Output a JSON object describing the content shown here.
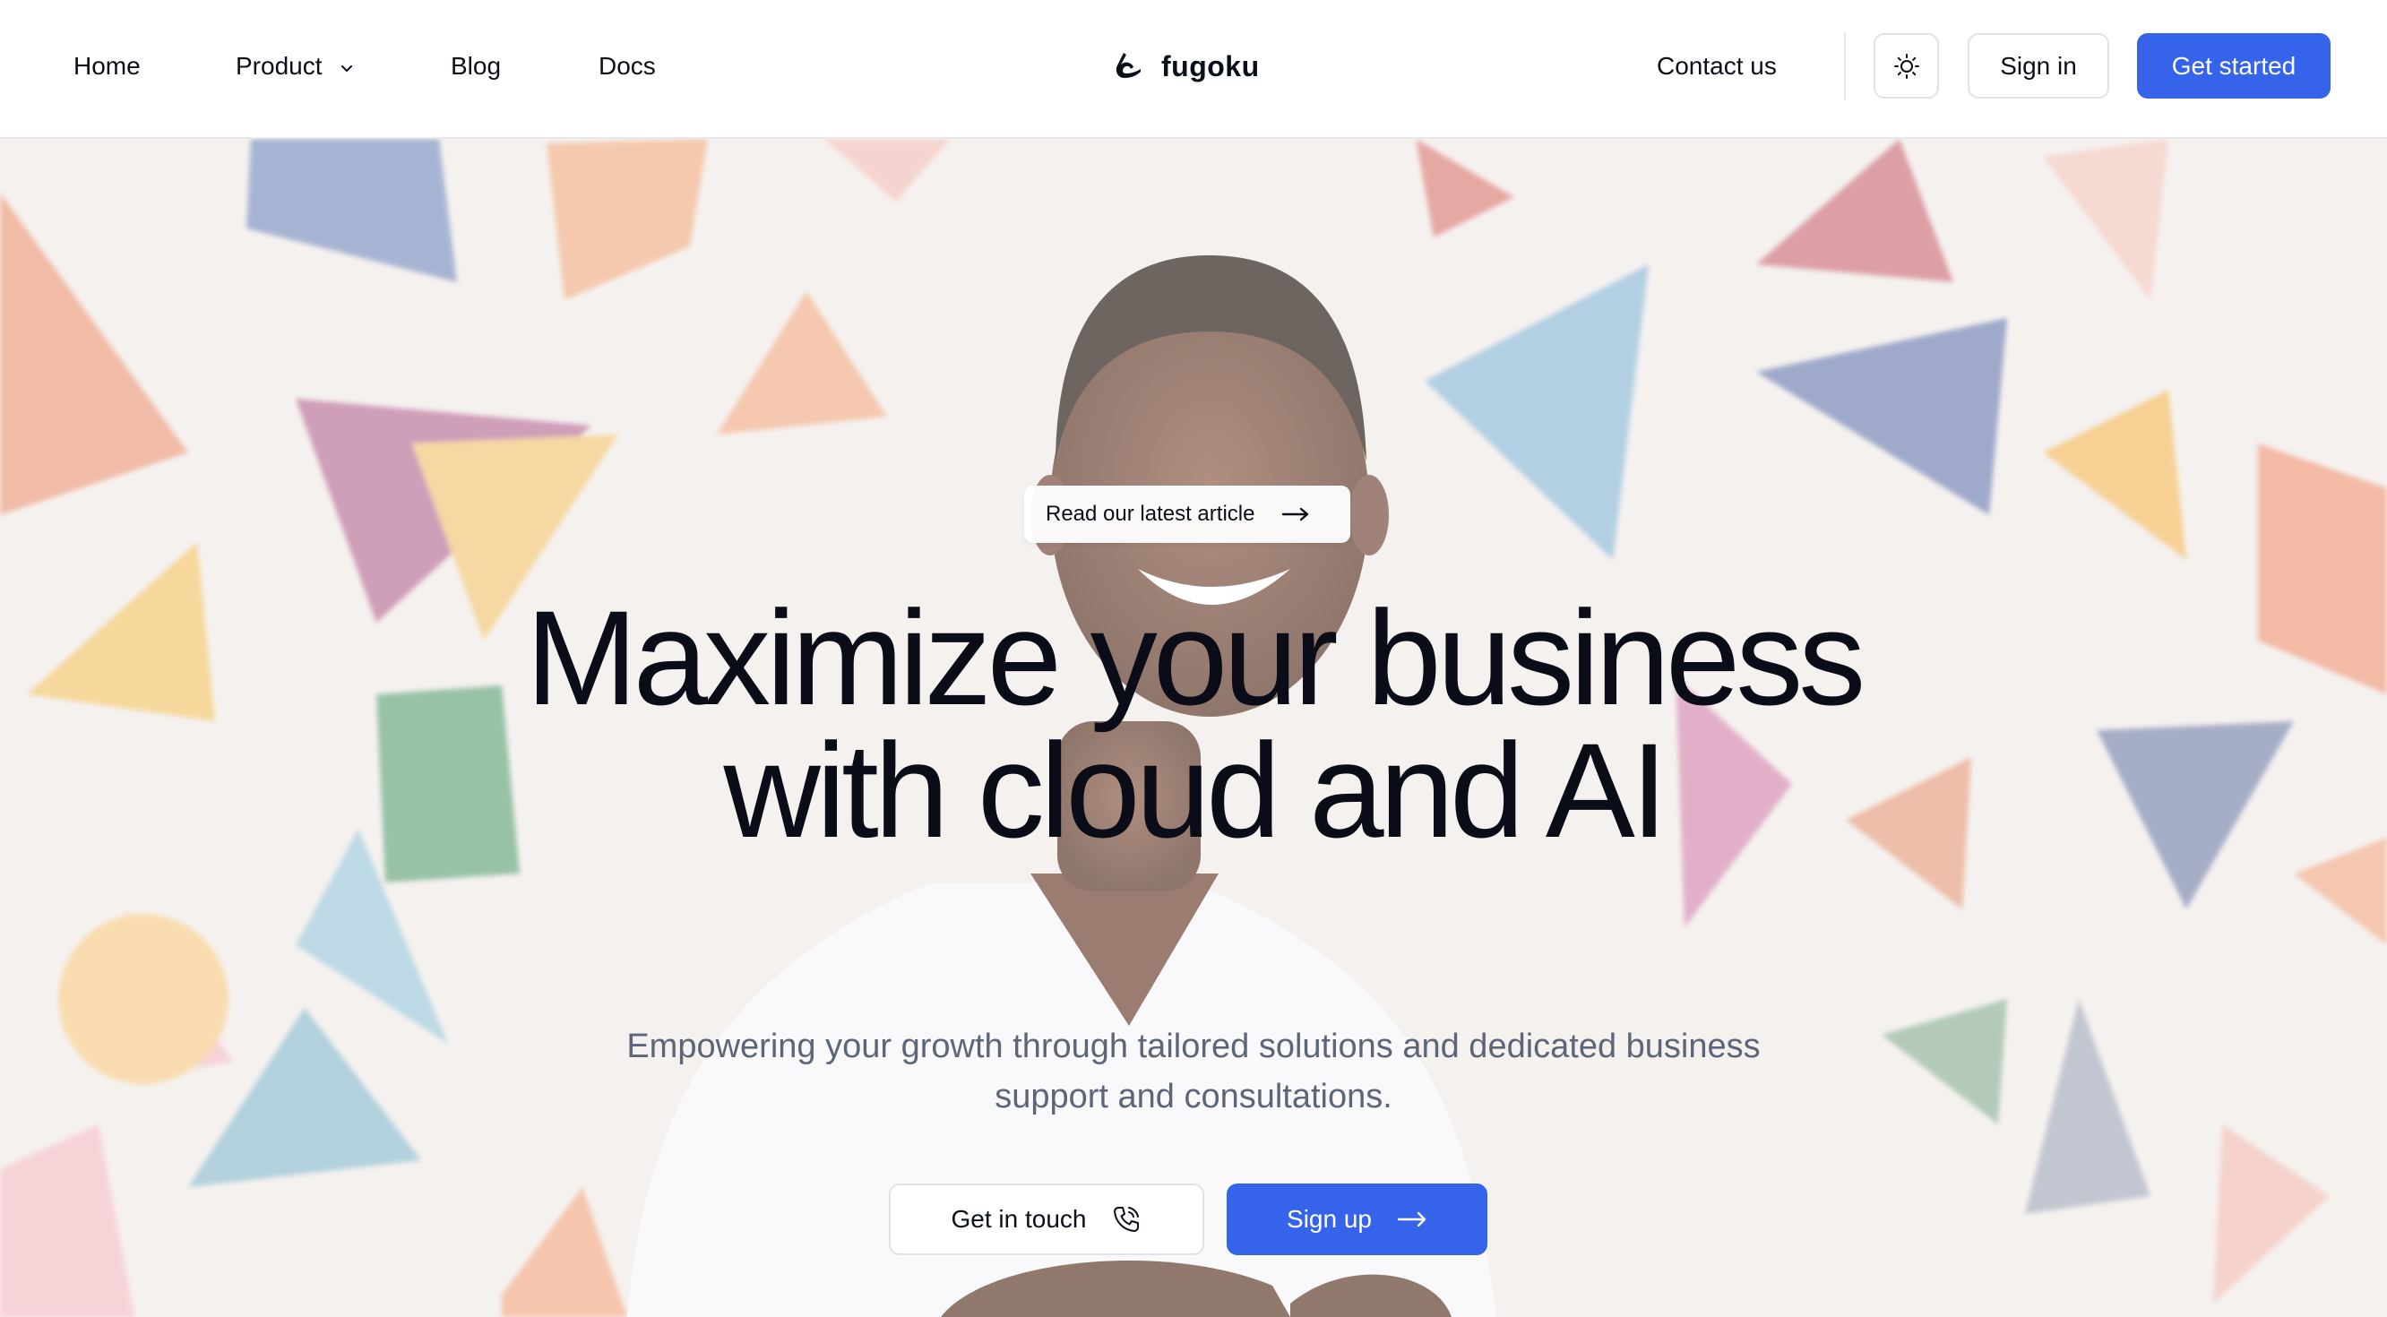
{
  "nav": {
    "links": [
      {
        "label": "Home"
      },
      {
        "label": "Product"
      },
      {
        "label": "Blog"
      },
      {
        "label": "Docs"
      }
    ],
    "brand": {
      "name": "fugoku",
      "logo_icon": "brand-logo-icon"
    },
    "contact_label": "Contact us",
    "theme_toggle_icon": "sun-icon",
    "sign_in_label": "Sign in",
    "get_started_label": "Get started"
  },
  "hero": {
    "pill_label": "Read our latest article",
    "headline_line1": "Maximize your business",
    "headline_line2": "with cloud and AI",
    "subhead_line1": "Empowering your growth through tailored solutions and dedicated business",
    "subhead_line2": "support and consultations.",
    "cta_secondary_label": "Get in touch",
    "cta_secondary_icon": "phone-icon",
    "cta_primary_label": "Sign up",
    "cta_primary_icon": "arrow-right-icon",
    "background_image": "smiling man in white t-shirt with arms crossed in front of wall with colorful triangles"
  },
  "colors": {
    "primary": "#3563e9",
    "text": "#0b0f1a",
    "muted_text": "#5d6578",
    "border": "#dfe2e7"
  }
}
